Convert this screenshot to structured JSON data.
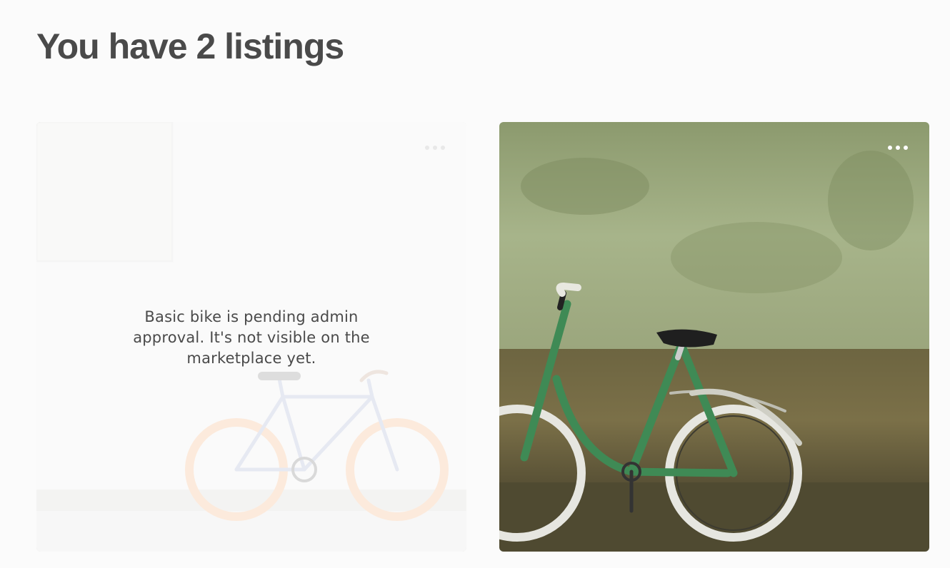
{
  "header": {
    "title": "You have 2 listings"
  },
  "listings": [
    {
      "status": "pending",
      "pending_message": "Basic bike is pending admin approval. It's not visible on the marketplace yet.",
      "image": "white-wall-bicycle-orange-wheels",
      "menu_icon": "more-horizontal-icon"
    },
    {
      "status": "published",
      "image": "green-bicycle-against-weathered-wall",
      "menu_icon": "more-horizontal-icon"
    }
  ],
  "colors": {
    "page_background": "#fbfbfb",
    "title_text": "#4a4a4a",
    "pending_overlay": "#ffffff",
    "menu_dots": "#ffffff"
  }
}
